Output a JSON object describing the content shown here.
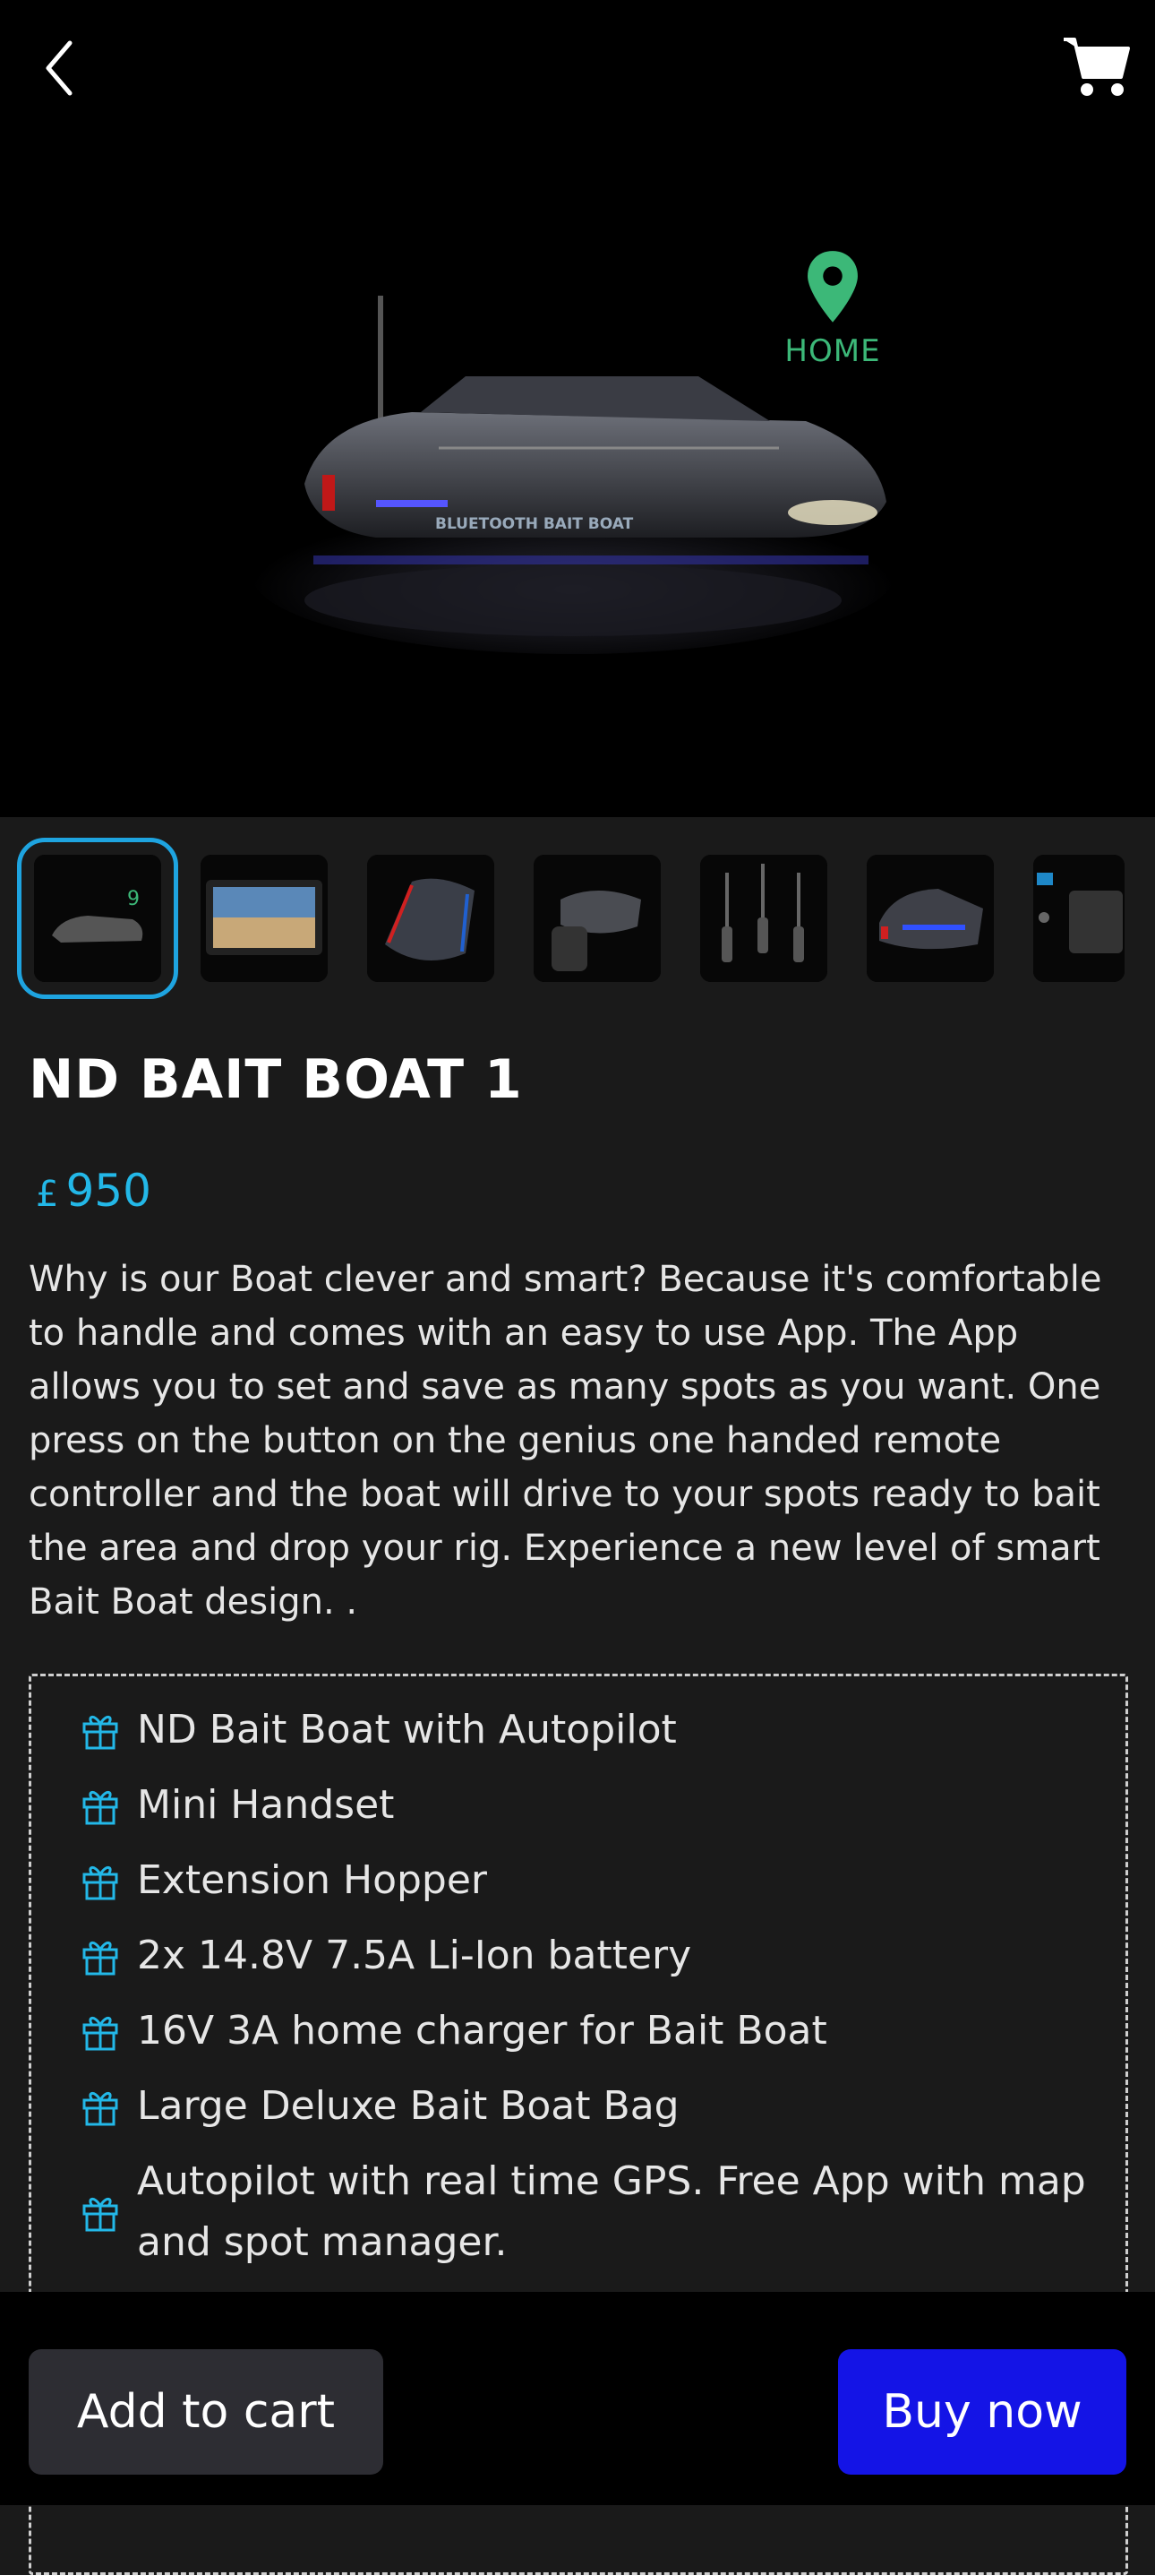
{
  "hero": {
    "home_label": "HOME",
    "boat_text": "BLUETOOTH BAIT BOAT"
  },
  "thumbnails": [
    {
      "name": "boat",
      "selected": true
    },
    {
      "name": "phone-app",
      "selected": false
    },
    {
      "name": "boat-top",
      "selected": false
    },
    {
      "name": "boat-handset",
      "selected": false
    },
    {
      "name": "rods",
      "selected": false
    },
    {
      "name": "boat-lights",
      "selected": false
    },
    {
      "name": "accessories",
      "selected": false
    }
  ],
  "product": {
    "title": "ND BAIT BOAT 1",
    "currency": "£",
    "price": "950",
    "description": "Why is our Boat clever and smart? Because it's comfortable to handle and comes with an easy to use App. The App allows you to set and save as many spots as you want. One press on the button on the genius one handed remote controller and the boat will drive to your spots ready to bait the area and drop your rig. Experience a new level of smart Bait Boat design. ."
  },
  "included": [
    "ND Bait Boat with Autopilot",
    "Mini Handset",
    "Extension Hopper",
    "2x 14.8V 7.5A Li-Ion battery",
    "16V 3A home charger for Bait Boat",
    "Large Deluxe Bait Boat Bag",
    "Autopilot with real time GPS. Free App with map and spot manager."
  ],
  "actions": {
    "add_to_cart": "Add to cart",
    "buy_now": "Buy now"
  },
  "colors": {
    "accent": "#23b8e8",
    "buy_button": "#1414e6",
    "cart_button": "#2d2d33",
    "home_marker": "#3cb878"
  },
  "icons": {
    "back": "chevron-left-icon",
    "cart": "cart-icon",
    "list_bullet": "gift-icon",
    "map_pin": "map-pin-icon"
  }
}
